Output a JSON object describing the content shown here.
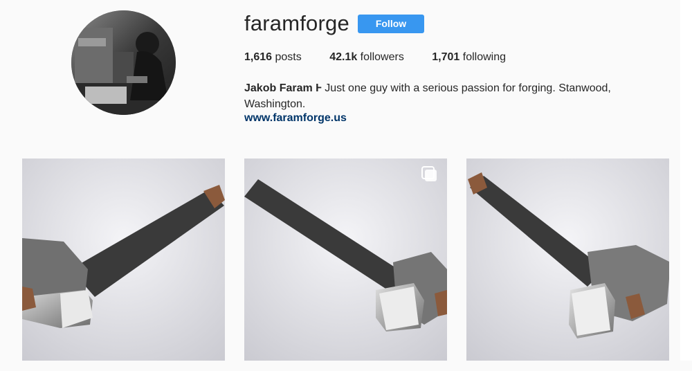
{
  "profile": {
    "username": "faramforge",
    "follow_label": "Follow",
    "stats": {
      "posts_count": "1,616",
      "posts_label": " posts",
      "followers_count": "42.1k",
      "followers_label": " followers",
      "following_count": "1,701",
      "following_label": " following"
    },
    "bio": {
      "name": "Jakob Faram ",
      "glyph": "Ⱶ",
      "text": " Just one guy with a serious passion for forging. Stanwood, Washington."
    },
    "website": "www.faramforge.us"
  },
  "posts": [
    {
      "subject": "hammer-photo",
      "multi": false
    },
    {
      "subject": "hammer-photo",
      "multi": true
    },
    {
      "subject": "hammer-photo",
      "multi": false
    }
  ],
  "colors": {
    "follow_button": "#3897f0",
    "link": "#003569",
    "background": "#fafafa"
  }
}
